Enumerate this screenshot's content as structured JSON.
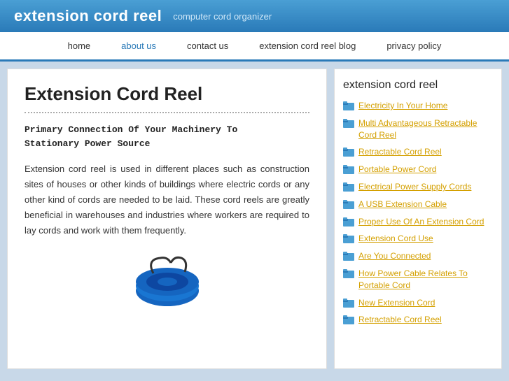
{
  "header": {
    "title": "extension cord reel",
    "subtitle": "computer cord organizer"
  },
  "nav": {
    "items": [
      {
        "label": "home",
        "active": false
      },
      {
        "label": "about us",
        "active": true
      },
      {
        "label": "contact us",
        "active": false
      },
      {
        "label": "extension cord reel blog",
        "active": false
      },
      {
        "label": "privacy policy",
        "active": false
      }
    ]
  },
  "main": {
    "heading": "Extension Cord Reel",
    "subheading": "Primary Connection Of Your Machinery To\nStationary Power Source",
    "body": "Extension cord reel is used in different places such as construction sites of houses or other kinds of buildings where electric cords or any other kind of cords are needed to be laid. These cord reels are greatly beneficial in warehouses and industries where workers are required to lay cords and work with them frequently."
  },
  "sidebar": {
    "title": "extension cord reel",
    "links": [
      {
        "label": "Electricity In Your Home"
      },
      {
        "label": "Multi Advantageous Retractable Cord Reel"
      },
      {
        "label": "Retractable Cord Reel"
      },
      {
        "label": "Portable Power Cord"
      },
      {
        "label": "Electrical Power Supply Cords"
      },
      {
        "label": "A USB Extension Cable"
      },
      {
        "label": "Proper Use Of An Extension Cord"
      },
      {
        "label": "Extension Cord Use"
      },
      {
        "label": "Are You Connected"
      },
      {
        "label": "How Power Cable Relates To Portable Cord"
      },
      {
        "label": "New Extension Cord"
      },
      {
        "label": "Retractable Cord Reel"
      }
    ]
  }
}
